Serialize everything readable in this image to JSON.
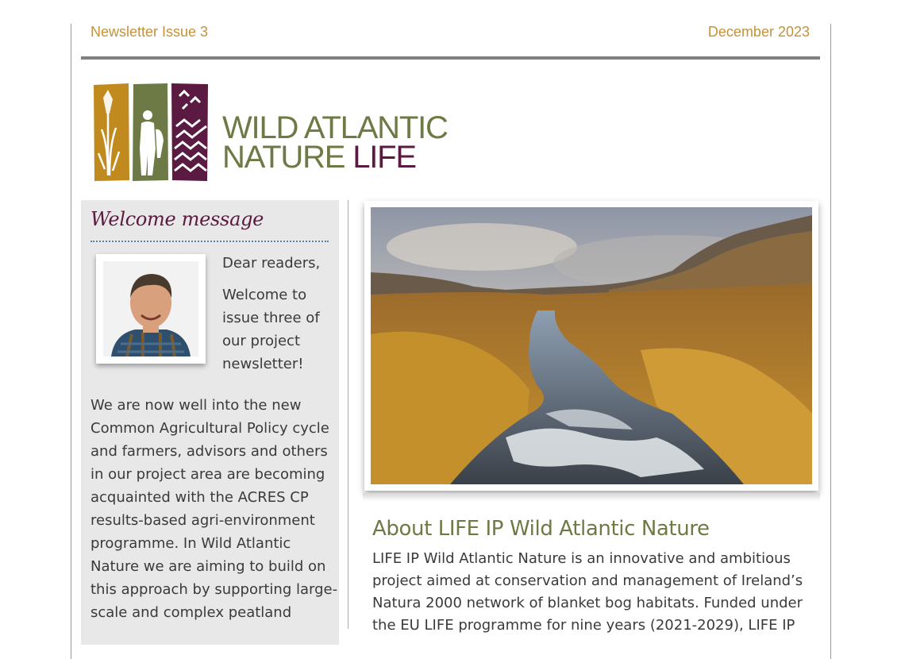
{
  "header": {
    "issue": "Newsletter Issue 3",
    "date": "December 2023"
  },
  "logo": {
    "line1": "WILD ATLANTIC",
    "line2_a": "NATURE ",
    "line2_b": "LIFE",
    "colors": {
      "ochre": "#c08a1e",
      "olive": "#6e7a45",
      "plum": "#5a1a42"
    }
  },
  "welcome": {
    "title": "Welcome message",
    "greeting": "Dear readers,",
    "intro_lines": [
      "Welcome to",
      "issue three of",
      "our project",
      "newsletter!"
    ],
    "body_lines": [
      "We are now well into the new",
      "Common Agricultural Policy cycle",
      "and farmers, advisors and others",
      "in our project area are becoming",
      "acquainted with the ACRES CP",
      "results-based agri-environment",
      "programme. In Wild Atlantic",
      "Nature we are aiming to build on",
      "this approach by supporting large-",
      "scale and complex peatland"
    ]
  },
  "about": {
    "title": "About LIFE IP Wild Atlantic Nature",
    "body_lines": [
      "LIFE IP Wild Atlantic Nature is an innovative and ambitious",
      "project aimed at conservation and management of Ireland’s",
      "Natura 2000 network of blanket bog habitats. Funded under",
      "the EU LIFE programme for nine years (2021-2029), LIFE IP"
    ]
  }
}
